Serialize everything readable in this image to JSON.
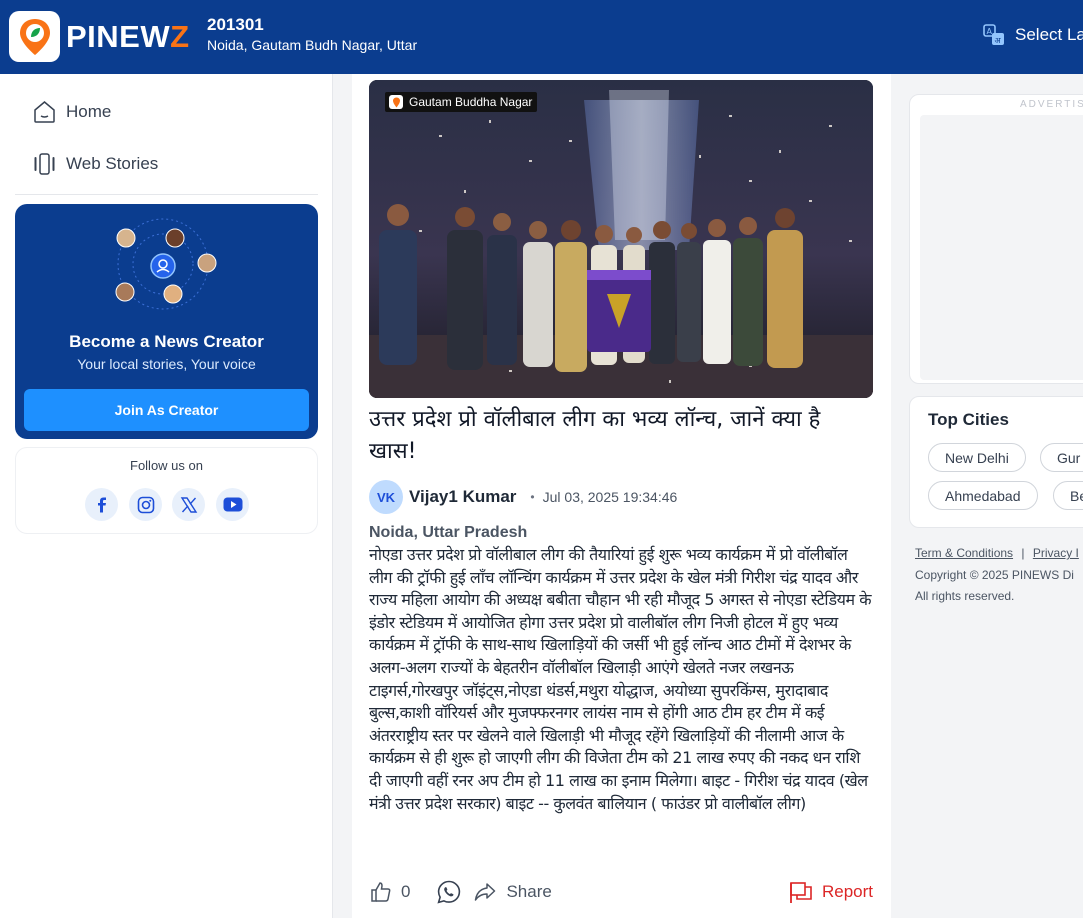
{
  "header": {
    "brand_prefix": "PINEW",
    "brand_suffix": "Z",
    "pin_code": "201301",
    "location": "Noida, Gautam Budh Nagar, Uttar",
    "language_label": "Select La"
  },
  "sidebar": {
    "nav": [
      {
        "label": "Home",
        "icon": "home-icon"
      },
      {
        "label": "Web Stories",
        "icon": "web-stories-icon"
      }
    ],
    "creator": {
      "title": "Become a News Creator",
      "subtitle": "Your local stories, Your voice",
      "button": "Join As Creator"
    },
    "follow": {
      "label": "Follow us on",
      "networks": [
        "facebook-icon",
        "instagram-icon",
        "x-icon",
        "youtube-icon"
      ]
    }
  },
  "article": {
    "location_tag": "Gautam Buddha Nagar",
    "title": "उत्तर प्रदेश प्रो वॉलीबाल लीग का भव्य लॉन्च, जानें क्या है खास!",
    "author_initials": "VK",
    "author": "Vijay1 Kumar",
    "published": "Jul 03, 2025 19:34:46",
    "place": "Noida, Uttar Pradesh",
    "body": "नोएडा उत्तर प्रदेश प्रो वॉलीबाल लीग की तैयारियां हुई शुरू भव्य कार्यक्रम में प्रो वॉलीबॉल लीग की ट्रॉफी हुई लॉंच लॉन्चिंग कार्यक्रम में उत्तर प्रदेश के खेल मंत्री गिरीश चंद्र यादव और राज्य महिला आयोग की अध्यक्ष बबीता चौहान भी रही मौजूद 5 अगस्त से नोएडा स्टेडियम के इंडोर स्टेडियम में आयोजित होगा उत्तर प्रदेश प्रो वालीबॉल लीग निजी होटल में हुए भव्य कार्यक्रम में ट्रॉफी के साथ-साथ खिलाड़ियों की जर्सी भी हुई लॉन्च आठ टीमों में देशभर के अलग-अलग राज्यों के बेहतरीन वॉलीबॉल खिलाड़ी आएंगे खेलते नजर लखनऊ टाइगर्स,गोरखपुर जॉइंट्स,नोएडा थंडर्स,मथुरा योद्धाज, अयोध्या सुपरकिंग्स, मुरादाबाद बुल्स,काशी वॉरियर्स और मुजफ्फरनगर लायंस नाम से होंगी आठ टीम हर टीम में कई अंतरराष्ट्रीय स्तर पर खेलने वाले खिलाड़ी भी मौजूद रहेंगे खिलाड़ियों की नीलामी आज के कार्यक्रम से ही शुरू हो जाएगी लीग की विजेता टीम को 21 लाख रुपए की नकद धन राशि दी जाएगी वहीं रनर अप टीम हो 11 लाख का इनाम मिलेगा। बाइट - गिरीश चंद्र यादव (खेल मंत्री उत्तर प्रदेश सरकार) बाइट -- कुलवंत बालियान ( फाउंडर प्रो वालीबॉल लीग)",
    "like_count": "0",
    "share_label": "Share",
    "report_label": "Report"
  },
  "right": {
    "ad_label": "ADVERTIS",
    "top_cities_title": "Top Cities",
    "cities": [
      "New Delhi",
      "Gur",
      "Ahmedabad",
      "Be"
    ],
    "footer_terms": "Term & Conditions",
    "footer_sep": "|",
    "footer_privacy": "Privacy I",
    "copyright": "Copyright © 2025 PINEWS Di",
    "rights": "All rights reserved."
  },
  "colors": {
    "header_bg": "#0b3d8f",
    "accent_orange": "#f97316",
    "join_button": "#1e90ff",
    "report_red": "#dc2626"
  }
}
